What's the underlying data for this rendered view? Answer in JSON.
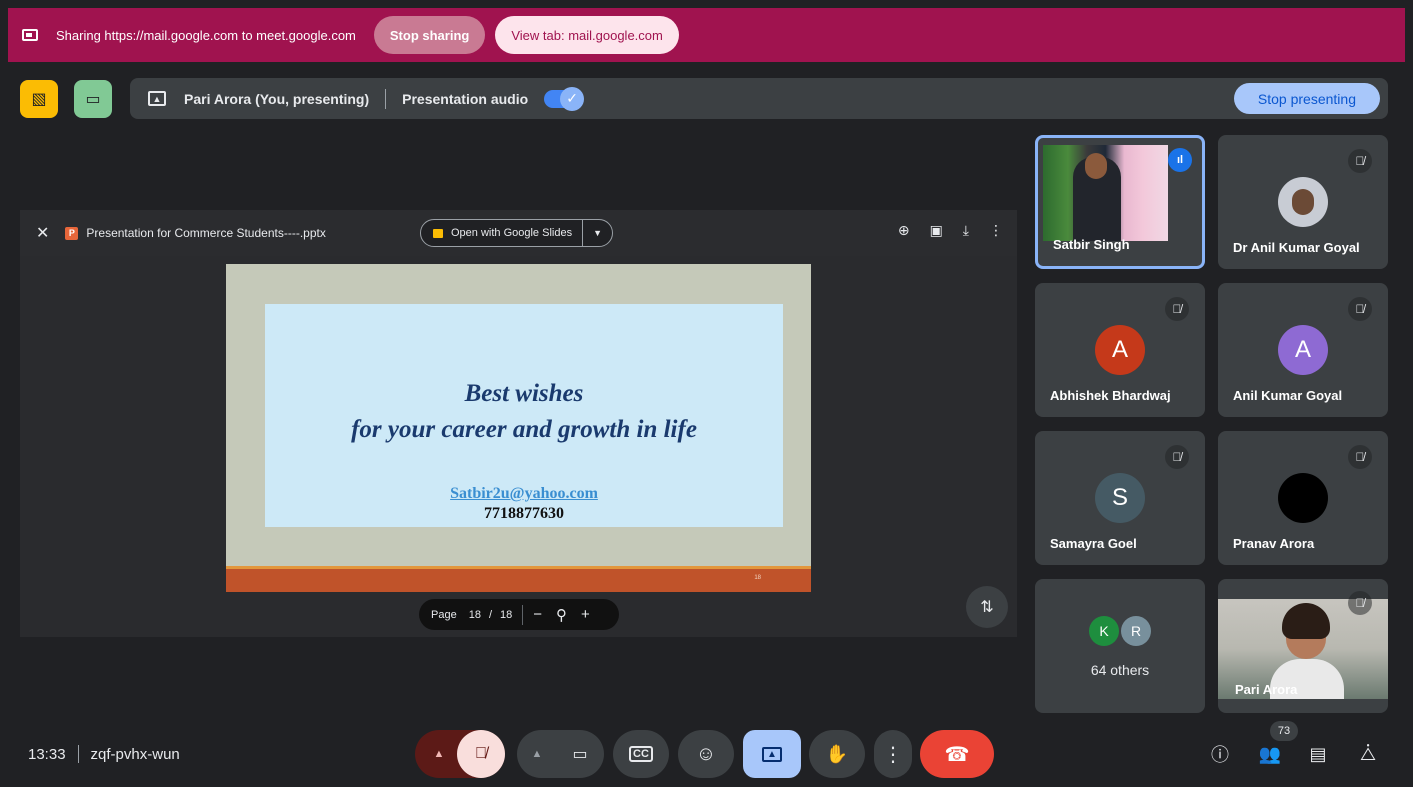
{
  "share_bar": {
    "text": "Sharing https://mail.google.com to meet.google.com",
    "stop_sharing": "Stop sharing",
    "view_tab": "View tab: mail.google.com"
  },
  "presenting_bar": {
    "presenter": "Pari Arora (You, presenting)",
    "audio_label": "Presentation audio",
    "audio_on": true,
    "stop_presenting": "Stop presenting"
  },
  "doc": {
    "file_name": "Presentation for Commerce Students----.pptx",
    "open_with": "Open with Google Slides",
    "slide": {
      "line1": "Best wishes",
      "line2": "for your career and growth in life",
      "email": "Satbir2u@yahoo.com",
      "phone": "7718877630",
      "slide_number": "18"
    },
    "pager": {
      "label": "Page",
      "current": "18",
      "sep": "/",
      "total": "18"
    }
  },
  "participants": [
    {
      "name": "Satbir Singh",
      "speaking": true
    },
    {
      "name": "Dr Anil Kumar Goyal",
      "muted": true
    },
    {
      "name": "Abhishek Bhardwaj",
      "initial": "A",
      "color": "#c5391a",
      "muted": true
    },
    {
      "name": "Anil Kumar Goyal",
      "initial": "A",
      "color": "#8e6ad3",
      "muted": true
    },
    {
      "name": "Samayra Goel",
      "initial": "S",
      "color": "#455a64",
      "muted": true
    },
    {
      "name": "Pranav Arora",
      "color": "#000000",
      "muted": true
    },
    {
      "name": "Pari Arora",
      "muted": true
    }
  ],
  "others": {
    "avatars": [
      {
        "initial": "K",
        "color": "#1e8e3e"
      },
      {
        "initial": "R",
        "color": "#78909c"
      }
    ],
    "label": "64 others"
  },
  "bottom": {
    "time": "13:33",
    "meeting_code": "zqf-pvhx-wun",
    "participant_count": "73"
  },
  "colors": {
    "share_bar": "#a0134f",
    "end_call": "#ea4335",
    "present_active": "#a8c7fa",
    "mic_off": "#f9dedc"
  }
}
